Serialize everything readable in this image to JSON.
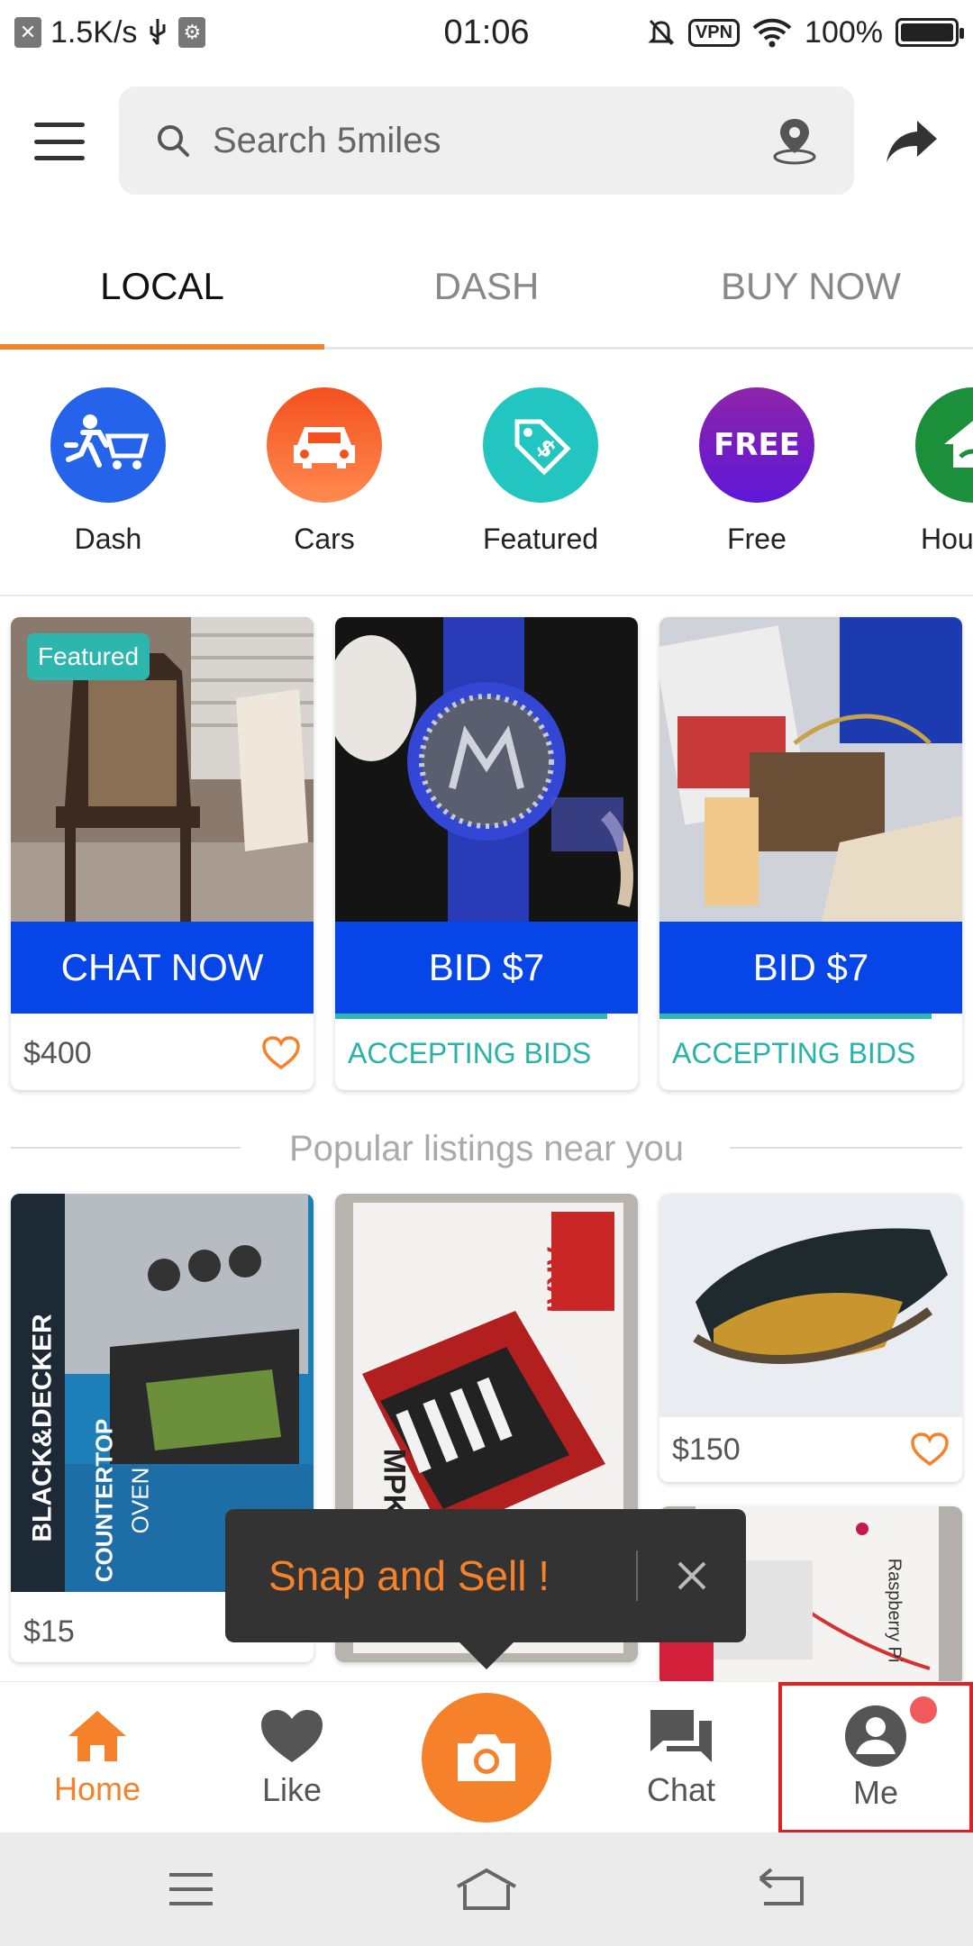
{
  "status_bar": {
    "net_speed": "1.5K/s",
    "time": "01:06",
    "vpn": "VPN",
    "battery": "100%",
    "battery_level": 1.0
  },
  "search": {
    "placeholder": "Search 5miles"
  },
  "tabs": [
    {
      "label": "LOCAL",
      "active": true
    },
    {
      "label": "DASH",
      "active": false
    },
    {
      "label": "BUY NOW",
      "active": false
    }
  ],
  "categories": [
    {
      "label": "Dash",
      "icon": "dash-cart-icon",
      "color": "#2563eb"
    },
    {
      "label": "Cars",
      "icon": "car-icon",
      "color": "#f4511e"
    },
    {
      "label": "Featured",
      "icon": "price-tag-icon",
      "color": "#22c5c0"
    },
    {
      "label": "Free",
      "icon": "free-icon",
      "icon_text": "FREE",
      "color": "#7b1fc7"
    },
    {
      "label": "Hou",
      "icon": "house-icon",
      "color": "#1b8f3a"
    }
  ],
  "featured_cards": [
    {
      "badge": "Featured",
      "cta": "CHAT NOW",
      "footer": "$400",
      "image": "dining-chair",
      "liked": false
    },
    {
      "cta": "BID $7",
      "footer": "ACCEPTING BIDS",
      "image": "blue-watch"
    },
    {
      "cta": "BID $7",
      "footer": "ACCEPTING BIDS",
      "image": "louis-vuitton-wallet"
    }
  ],
  "section_title": "Popular listings near you",
  "listings": [
    {
      "price": "$15",
      "image": "black-decker-countertop-oven",
      "image_text_1": "BLACK&DECKER",
      "image_text_2": "COUNTERTOP",
      "image_text_3": "OVEN"
    },
    {
      "price": "",
      "image": "akai-mpk-keyboard",
      "image_text_1": "AKAI",
      "image_text_2": "MPK"
    },
    {
      "price": "$150",
      "image": "sneaker"
    },
    {
      "price": "",
      "image": "raspberry-pi-keyboard",
      "image_text_1": "Raspberry Pi"
    }
  ],
  "toast": {
    "text": "Snap and Sell !"
  },
  "bottom_nav": [
    {
      "label": "Home",
      "icon": "home-icon",
      "active": true
    },
    {
      "label": "Like",
      "icon": "heart-icon",
      "active": false
    },
    {
      "label": "",
      "icon": "camera-icon",
      "active": false
    },
    {
      "label": "Chat",
      "icon": "chat-icon",
      "active": false
    },
    {
      "label": "Me",
      "icon": "account-icon",
      "active": false
    }
  ],
  "colors": {
    "accent": "#f5822a",
    "cta_blue": "#0645e8",
    "teal": "#27b3a9"
  }
}
